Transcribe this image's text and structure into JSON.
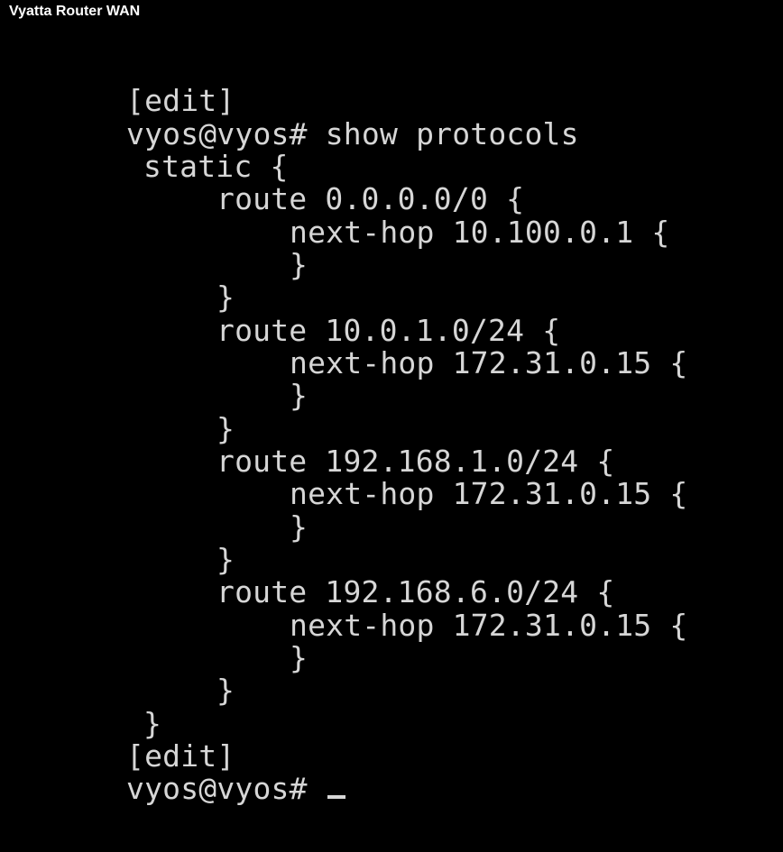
{
  "window": {
    "title": "Vyatta Router WAN"
  },
  "terminal": {
    "lines": [
      "[edit]",
      "vyos@vyos# show protocols",
      "static {",
      "route 0.0.0.0/0 {",
      "next-hop 10.100.0.1 {",
      "}",
      "}",
      "route 10.0.1.0/24 {",
      "next-hop 172.31.0.15 {",
      "}",
      "}",
      "route 192.168.1.0/24 {",
      "next-hop 172.31.0.15 {",
      "}",
      "}",
      "route 192.168.6.0/24 {",
      "next-hop 172.31.0.15 {",
      "}",
      "}",
      "}",
      "[edit]",
      "vyos@vyos# "
    ],
    "colors": {
      "background": "#000000",
      "text": "#d6d6d6"
    }
  }
}
